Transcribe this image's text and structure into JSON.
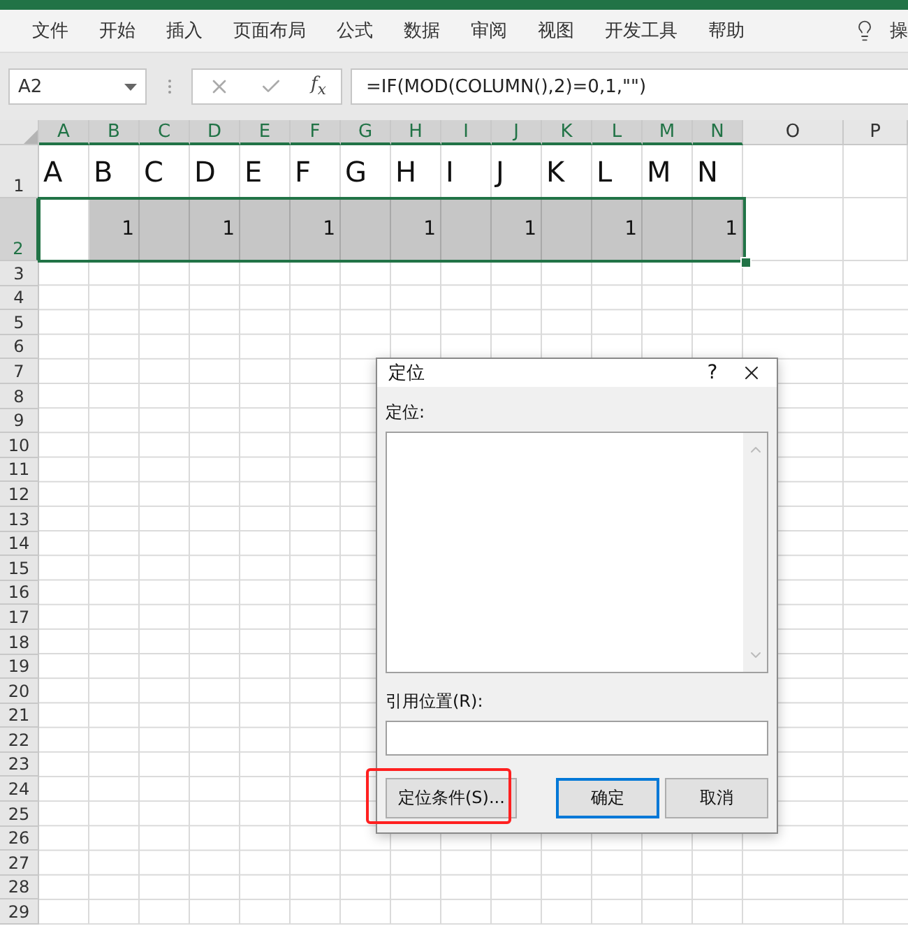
{
  "menu": {
    "items": [
      "文件",
      "开始",
      "插入",
      "页面布局",
      "公式",
      "数据",
      "审阅",
      "视图",
      "开发工具",
      "帮助"
    ],
    "tell_me": "操"
  },
  "formula_bar": {
    "name_box": "A2",
    "fx_label": "f$_{x}$",
    "formula": "=IF(MOD(COLUMN(),2)=0,1,\"\")"
  },
  "sheet": {
    "columns": [
      {
        "label": "A",
        "selected": true
      },
      {
        "label": "B",
        "selected": true
      },
      {
        "label": "C",
        "selected": true
      },
      {
        "label": "D",
        "selected": true
      },
      {
        "label": "E",
        "selected": true
      },
      {
        "label": "F",
        "selected": true
      },
      {
        "label": "G",
        "selected": true
      },
      {
        "label": "H",
        "selected": true
      },
      {
        "label": "I",
        "selected": true
      },
      {
        "label": "J",
        "selected": true
      },
      {
        "label": "K",
        "selected": true
      },
      {
        "label": "L",
        "selected": true
      },
      {
        "label": "M",
        "selected": true
      },
      {
        "label": "N",
        "selected": true
      },
      {
        "label": "O",
        "selected": false
      },
      {
        "label": "P",
        "selected": false
      }
    ],
    "rows": [
      {
        "label": "1",
        "selected": false,
        "cells": [
          {
            "text": "A",
            "highlighted": false
          },
          {
            "text": "B",
            "highlighted": false
          },
          {
            "text": "C",
            "highlighted": false
          },
          {
            "text": "D",
            "highlighted": false
          },
          {
            "text": "E",
            "highlighted": false
          },
          {
            "text": "F",
            "highlighted": false
          },
          {
            "text": "G",
            "highlighted": false
          },
          {
            "text": "H",
            "highlighted": false
          },
          {
            "text": "I",
            "highlighted": false
          },
          {
            "text": "J",
            "highlighted": false
          },
          {
            "text": "K",
            "highlighted": false
          },
          {
            "text": "L",
            "highlighted": false
          },
          {
            "text": "M",
            "highlighted": false
          },
          {
            "text": "N",
            "highlighted": false
          }
        ]
      },
      {
        "label": "2",
        "selected": true,
        "cells": [
          {
            "text": "",
            "highlighted": false
          },
          {
            "text": "1",
            "highlighted": true
          },
          {
            "text": "",
            "highlighted": true
          },
          {
            "text": "1",
            "highlighted": true
          },
          {
            "text": "",
            "highlighted": true
          },
          {
            "text": "1",
            "highlighted": true
          },
          {
            "text": "",
            "highlighted": true
          },
          {
            "text": "1",
            "highlighted": true
          },
          {
            "text": "",
            "highlighted": true
          },
          {
            "text": "1",
            "highlighted": true
          },
          {
            "text": "",
            "highlighted": true
          },
          {
            "text": "1",
            "highlighted": true
          },
          {
            "text": "",
            "highlighted": true
          },
          {
            "text": "1",
            "highlighted": true
          }
        ]
      },
      {
        "label": "3",
        "selected": false
      },
      {
        "label": "4",
        "selected": false
      },
      {
        "label": "5",
        "selected": false
      },
      {
        "label": "6",
        "selected": false
      },
      {
        "label": "7",
        "selected": false
      },
      {
        "label": "8",
        "selected": false
      },
      {
        "label": "9",
        "selected": false
      },
      {
        "label": "10",
        "selected": false
      },
      {
        "label": "11",
        "selected": false
      },
      {
        "label": "12",
        "selected": false
      },
      {
        "label": "13",
        "selected": false
      },
      {
        "label": "14",
        "selected": false
      },
      {
        "label": "15",
        "selected": false
      },
      {
        "label": "16",
        "selected": false
      },
      {
        "label": "17",
        "selected": false
      },
      {
        "label": "18",
        "selected": false
      },
      {
        "label": "19",
        "selected": false
      },
      {
        "label": "20",
        "selected": false
      },
      {
        "label": "21",
        "selected": false
      },
      {
        "label": "22",
        "selected": false
      },
      {
        "label": "23",
        "selected": false
      },
      {
        "label": "24",
        "selected": false
      },
      {
        "label": "25",
        "selected": false
      },
      {
        "label": "26",
        "selected": false
      },
      {
        "label": "27",
        "selected": false
      },
      {
        "label": "28",
        "selected": false
      },
      {
        "label": "29",
        "selected": false
      }
    ]
  },
  "dialog": {
    "title": "定位",
    "help": "?",
    "list_label": "定位:",
    "reference_label": "引用位置(R):",
    "buttons": [
      {
        "label": "定位条件(S)...",
        "default": false,
        "highlighted": true
      },
      {
        "label": "确定",
        "default": true,
        "highlighted": false
      },
      {
        "label": "取消",
        "default": false,
        "highlighted": false
      }
    ]
  }
}
